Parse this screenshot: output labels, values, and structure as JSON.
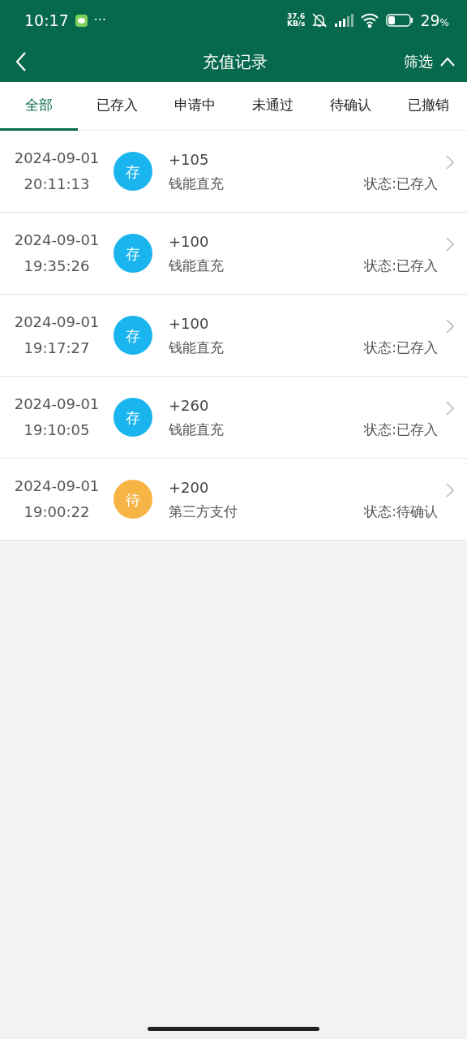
{
  "status_bar": {
    "time": "10:17",
    "more": "···",
    "speed": "37.6",
    "speed_unit": "KB/s",
    "battery": "29",
    "battery_unit": "%"
  },
  "header": {
    "title": "充值记录",
    "filter": "筛选"
  },
  "tabs": [
    {
      "label": "全部",
      "selected": true
    },
    {
      "label": "已存入",
      "selected": false
    },
    {
      "label": "申请中",
      "selected": false
    },
    {
      "label": "未通过",
      "selected": false
    },
    {
      "label": "待确认",
      "selected": false
    },
    {
      "label": "已撤销",
      "selected": false
    }
  ],
  "records": [
    {
      "date": "2024-09-01",
      "time": "20:11:13",
      "badge": "存",
      "color": "#1ab4ee",
      "amount": "+105",
      "method": "钱能直充",
      "status": "状态:已存入"
    },
    {
      "date": "2024-09-01",
      "time": "19:35:26",
      "badge": "存",
      "color": "#1ab4ee",
      "amount": "+100",
      "method": "钱能直充",
      "status": "状态:已存入"
    },
    {
      "date": "2024-09-01",
      "time": "19:17:27",
      "badge": "存",
      "color": "#1ab4ee",
      "amount": "+100",
      "method": "钱能直充",
      "status": "状态:已存入"
    },
    {
      "date": "2024-09-01",
      "time": "19:10:05",
      "badge": "存",
      "color": "#1ab4ee",
      "amount": "+260",
      "method": "钱能直充",
      "status": "状态:已存入"
    },
    {
      "date": "2024-09-01",
      "time": "19:00:22",
      "badge": "待",
      "color": "#f6b445",
      "amount": "+200",
      "method": "第三方支付",
      "status": "状态:待确认"
    }
  ]
}
